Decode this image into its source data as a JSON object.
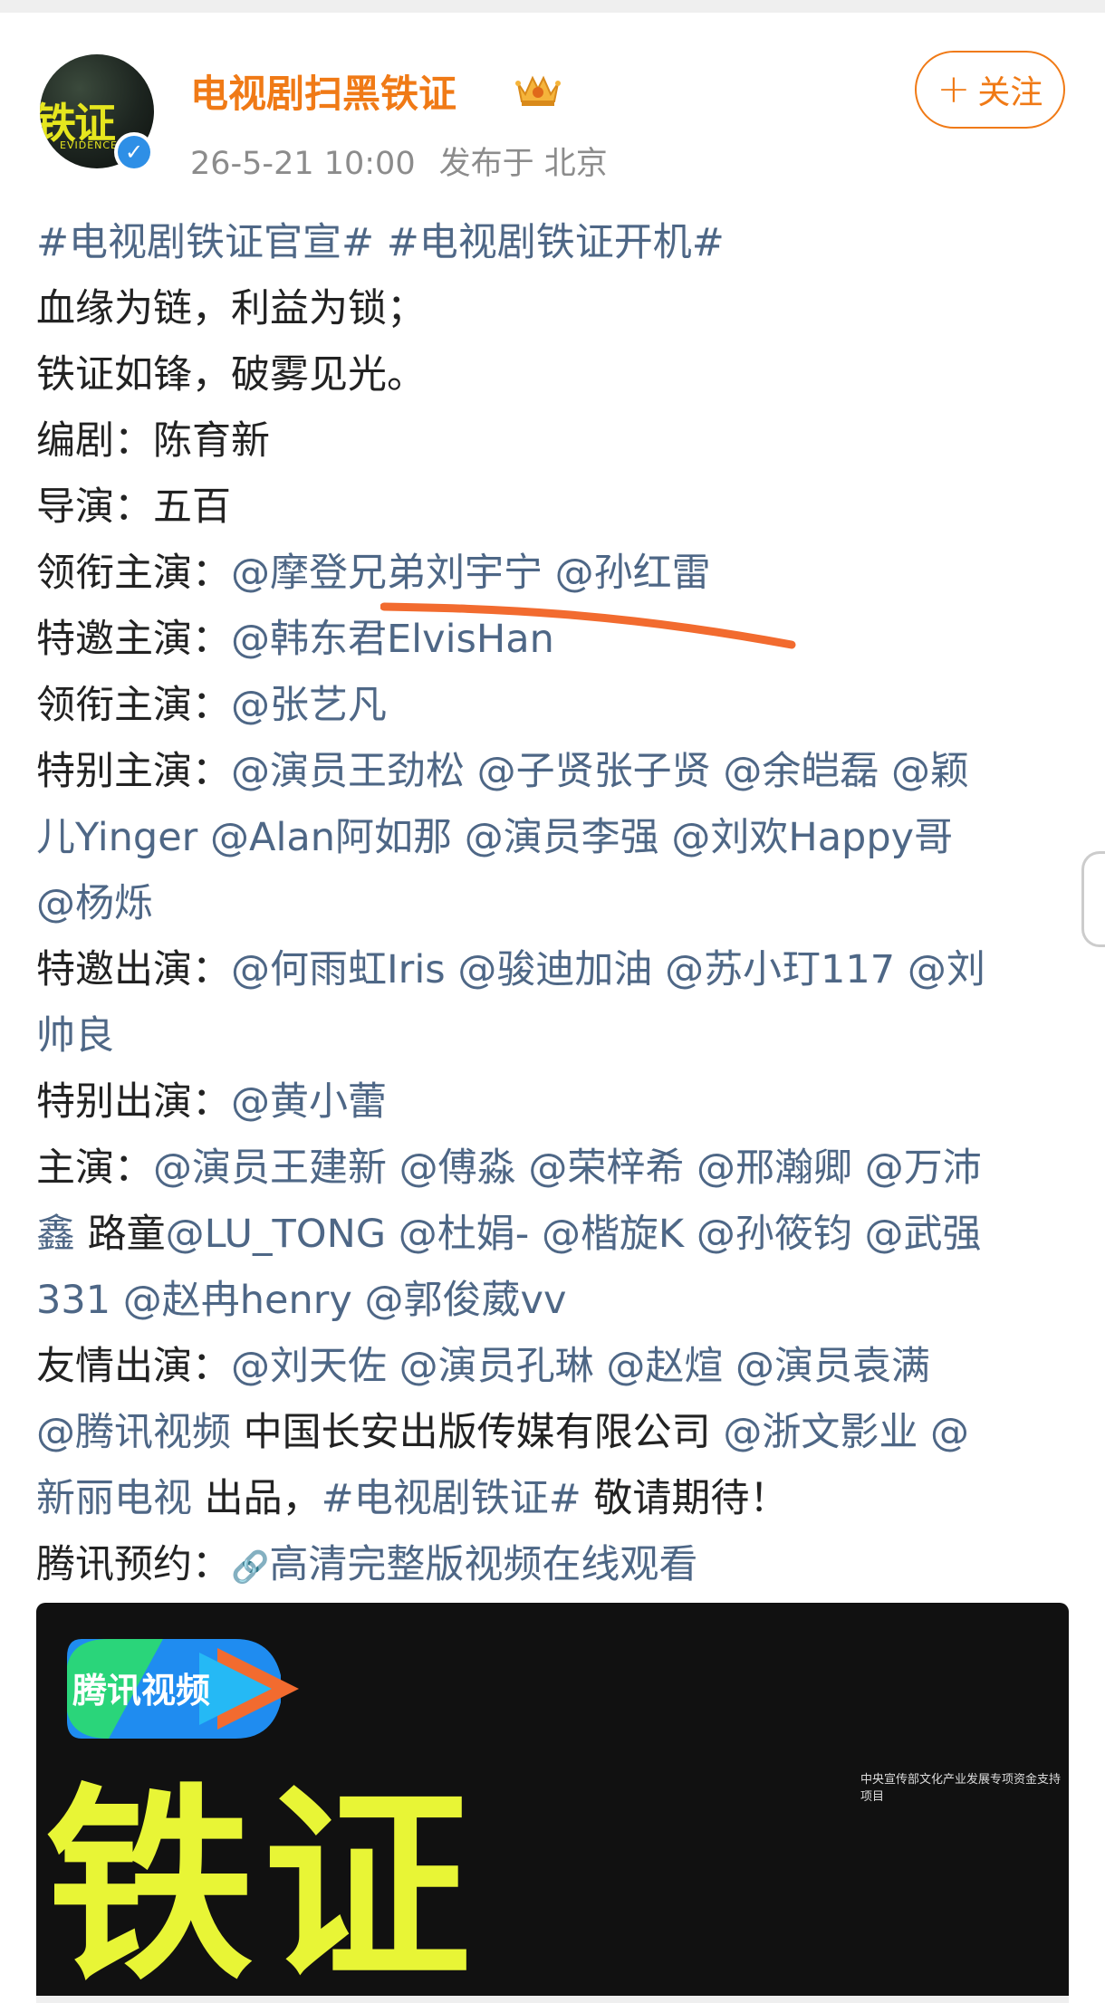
{
  "post": {
    "account": {
      "name": "电视剧扫黑铁证",
      "avatar_text": "铁证",
      "avatar_subtext": "EVIDENCE",
      "verified_mark": "✓",
      "time": "26-5-21 10:00",
      "location": "发布于 北京",
      "follow_plus": "+",
      "follow_label": "关注"
    },
    "content": {
      "hashtags_line": [
        "#电视剧铁证官宣#",
        "#电视剧铁证开机#"
      ],
      "line2": "血缘为链，利益为锁；",
      "line3": "铁证如锋，破雾见光。",
      "line4": "编剧：陈育新",
      "line5": "导演：五百",
      "lead1_label": "领衔主演：",
      "lead1_mentions": [
        "@摩登兄弟刘宇宁",
        "@孙红雷"
      ],
      "special_guest_label": "特邀主演：",
      "special_guest_mention": "@韩东君ElvisHan",
      "lead2_label": "领衔主演：",
      "lead2_mention": "@张艺凡",
      "special_lead_label": "特别主演：",
      "special_lead_l1": [
        "@演员王劲松",
        "@子贤张子贤",
        "@余皑磊",
        "@颖"
      ],
      "special_lead_l2": [
        "儿Yinger",
        "@Alan阿如那",
        "@演员李强",
        "@刘欢Happy哥"
      ],
      "special_lead_l3": [
        "@杨烁"
      ],
      "guest_label": "特邀出演：",
      "guest_l1": [
        "@何雨虹Iris",
        "@骏迪加油",
        "@苏小玎117",
        "@刘"
      ],
      "guest_l2": [
        "帅良"
      ],
      "special_app_label": "特别出演：",
      "special_app_mention": "@黄小蕾",
      "main_label": "主演：",
      "main_l1": [
        "@演员王建新",
        "@傅淼",
        "@荣梓希",
        "@邢瀚卿",
        "@万沛"
      ],
      "main_l2_a": "鑫",
      "main_l2_b": "路童",
      "main_l2_rest": [
        "@LU_TONG",
        "@杜娟-",
        "@楷旋K",
        "@孙筱钧",
        "@武强"
      ],
      "main_l3": [
        "331",
        "@赵冉henry",
        "@郭俊葳vv"
      ],
      "friend_label": "友情出演：",
      "friend_l1": [
        "@刘天佐",
        "@演员孔琳",
        "@赵煊",
        "@演员袁满"
      ],
      "friend_l2_a": "@腾讯视频",
      "friend_l2_b": "中国长安出版传媒有限公司",
      "friend_l2_c": "@浙文影业",
      "friend_l2_d": "@",
      "friend_l3_a": "新丽电视",
      "friend_l3_b": "出品，",
      "friend_l3_c": "#电视剧铁证#",
      "friend_l3_d": "敬请期待！",
      "reserve_label": "腾讯预约：",
      "reserve_link_icon": "🔗",
      "reserve_link": "高清完整版视频在线观看"
    },
    "poster": {
      "logo_text": "腾讯视频",
      "caption": "中央宣传部文化产业发展专项资金支持项目",
      "title": "铁证"
    }
  },
  "colors": {
    "accent_orange": "#f07a16",
    "link_blue": "#4e6786",
    "text": "#222222",
    "meta_gray": "#8c8c8c",
    "poster_yellow": "#e8f536"
  }
}
